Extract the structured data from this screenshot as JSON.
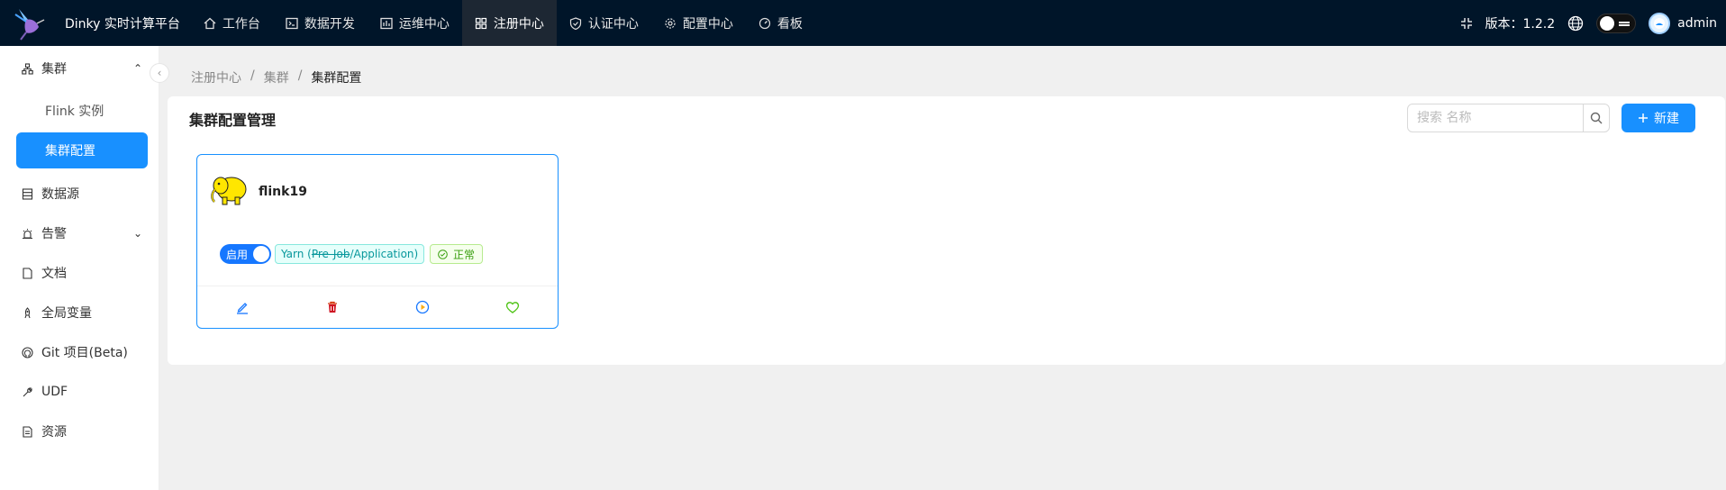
{
  "app": {
    "title": "Dinky 实时计算平台"
  },
  "nav": [
    {
      "label": "工作台",
      "icon": "home-icon"
    },
    {
      "label": "数据开发",
      "icon": "code-icon"
    },
    {
      "label": "运维中心",
      "icon": "dashboard-icon"
    },
    {
      "label": "注册中心",
      "icon": "grid-icon",
      "active": true
    },
    {
      "label": "认证中心",
      "icon": "shield-icon"
    },
    {
      "label": "配置中心",
      "icon": "gear-icon"
    },
    {
      "label": "看板",
      "icon": "gauge-icon"
    }
  ],
  "topbar": {
    "version_label": "版本：1.2.2",
    "username": "admin"
  },
  "sidebar": {
    "cluster": {
      "label": "集群",
      "submenu": [
        "Flink 实例",
        "集群配置"
      ],
      "active_sub": "集群配置"
    },
    "items": [
      {
        "label": "数据源",
        "icon": "database-icon"
      },
      {
        "label": "告警",
        "icon": "alarm-icon"
      },
      {
        "label": "文档",
        "icon": "document-icon"
      },
      {
        "label": "全局变量",
        "icon": "rocket-icon"
      },
      {
        "label": "Git 项目(Beta)",
        "icon": "github-icon"
      },
      {
        "label": "UDF",
        "icon": "tool-icon"
      },
      {
        "label": "资源",
        "icon": "file-icon"
      }
    ]
  },
  "breadcrumb": [
    "注册中心",
    "集群",
    "集群配置"
  ],
  "breadcrumb_sep": "/",
  "panel": {
    "title": "集群配置管理",
    "search_placeholder": "搜索 名称",
    "new_button_label": "新建"
  },
  "card": {
    "name": "flink19",
    "enabled_label": "启用",
    "type_prefix": "Yarn (",
    "type_strike": "Pre-Job",
    "type_suffix": "/Application)",
    "status_label": "正常",
    "status_color": "#389e0d",
    "accent": "#1890ff"
  }
}
